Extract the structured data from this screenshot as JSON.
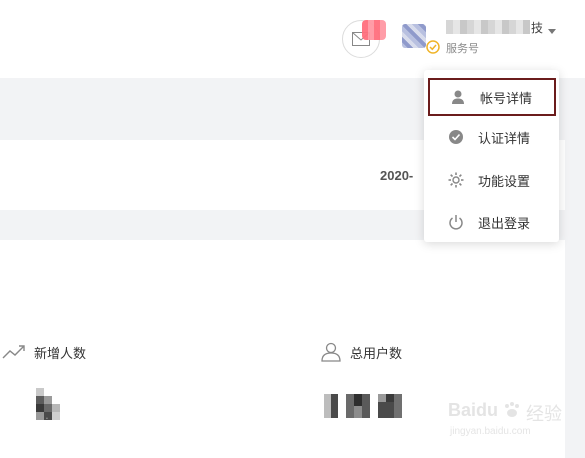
{
  "header": {
    "account_name_suffix": "技",
    "account_type": "服务号"
  },
  "date_card": {
    "date_text": "2020-"
  },
  "stats": [
    {
      "label": "新增人数",
      "icon": "trend-icon",
      "value": "6"
    },
    {
      "label": "总用户数",
      "icon": "user-outline-icon",
      "value": "102"
    }
  ],
  "dropdown": {
    "items": [
      {
        "label": "帐号详情",
        "icon": "user-icon",
        "highlighted": true
      },
      {
        "label": "认证详情",
        "icon": "check-circle-icon"
      },
      {
        "label": "功能设置",
        "icon": "gear-icon"
      },
      {
        "label": "退出登录",
        "icon": "power-icon"
      }
    ]
  },
  "watermark": {
    "brand": "Baidu",
    "cn": "经验",
    "url": "jingyan.baidu.com"
  },
  "colors": {
    "highlight_border": "#6b1c1c",
    "verify_icon": "#f0b429"
  }
}
